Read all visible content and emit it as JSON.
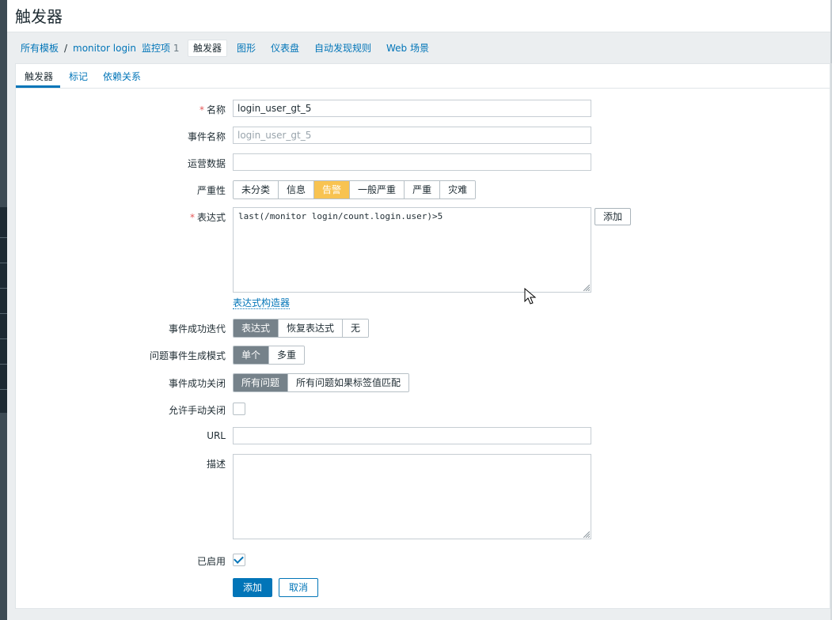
{
  "page_title": "触发器",
  "breadcrumb": {
    "all_templates": "所有模板",
    "separator": "/",
    "template_name": "monitor login",
    "items_label": "监控项",
    "items_count": "1",
    "triggers": "触发器",
    "graphs": "图形",
    "dashboards": "仪表盘",
    "discovery_rules": "自动发现规则",
    "web_scenarios": "Web 场景"
  },
  "tabs": {
    "trigger": "触发器",
    "tags": "标记",
    "dependencies": "依赖关系"
  },
  "form": {
    "required_mark": "*",
    "name_label": "名称",
    "name_value": "login_user_gt_5",
    "event_name_label": "事件名称",
    "event_name_placeholder": "login_user_gt_5",
    "opdata_label": "运营数据",
    "opdata_value": "",
    "severity_label": "严重性",
    "severity_options": [
      "未分类",
      "信息",
      "告警",
      "一般严重",
      "严重",
      "灾难"
    ],
    "severity_selected": "告警",
    "expression_label": "表达式",
    "expression_value": "last(/monitor login/count.login.user)>5",
    "expression_add_button": "添加",
    "expression_constructor_link": "表达式构造器",
    "ok_event_gen_label": "事件成功迭代",
    "ok_event_gen_options": [
      "表达式",
      "恢复表达式",
      "无"
    ],
    "ok_event_gen_selected": "表达式",
    "problem_mode_label": "问题事件生成模式",
    "problem_mode_options": [
      "单个",
      "多重"
    ],
    "problem_mode_selected": "单个",
    "ok_close_label": "事件成功关闭",
    "ok_close_options": [
      "所有问题",
      "所有问题如果标签值匹配"
    ],
    "ok_close_selected": "所有问题",
    "manual_close_label": "允许手动关闭",
    "manual_close_checked": false,
    "url_label": "URL",
    "url_value": "",
    "description_label": "描述",
    "description_value": "",
    "enabled_label": "已启用",
    "enabled_checked": true,
    "add_button": "添加",
    "cancel_button": "取消"
  },
  "colors": {
    "accent": "#0275b8",
    "severity_warning": "#f8c351",
    "segment_selected": "#76828a",
    "required": "#e45959"
  }
}
